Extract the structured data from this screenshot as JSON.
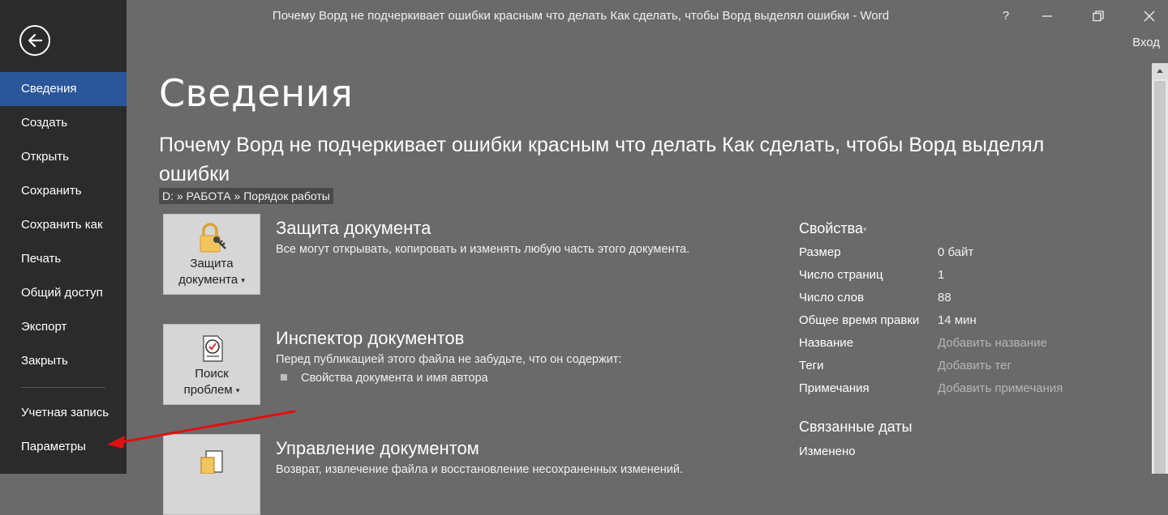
{
  "window": {
    "title": "Почему Ворд не подчеркивает ошибки красным что делать Как сделать, чтобы Ворд выделял ошибки - Word",
    "help": "?",
    "signin": "Вход"
  },
  "sidebar": {
    "items": [
      {
        "label": "Сведения",
        "active": true
      },
      {
        "label": "Создать"
      },
      {
        "label": "Открыть"
      },
      {
        "label": "Сохранить"
      },
      {
        "label": "Сохранить как"
      },
      {
        "label": "Печать"
      },
      {
        "label": "Общий доступ"
      },
      {
        "label": "Экспорт"
      },
      {
        "label": "Закрыть"
      },
      {
        "label": "Учетная запись"
      },
      {
        "label": "Параметры"
      }
    ]
  },
  "main": {
    "title": "Сведения",
    "doc_title": "Почему Ворд не подчеркивает ошибки красным что делать Как сделать, чтобы Ворд выделял ошибки",
    "path": "D: » РАБОТА » Порядок работы",
    "sections": [
      {
        "tile_line1": "Защита",
        "tile_line2": "документа",
        "heading": "Защита документа",
        "desc": "Все могут открывать, копировать и изменять любую часть этого документа."
      },
      {
        "tile_line1": "Поиск",
        "tile_line2": "проблем",
        "heading": "Инспектор документов",
        "desc": "Перед публикацией этого файла не забудьте, что он содержит:",
        "bullet": "Свойства документа и имя автора"
      },
      {
        "heading": "Управление документом",
        "desc": "Возврат, извлечение файла и восстановление несохраненных изменений."
      }
    ]
  },
  "properties": {
    "heading": "Свойства",
    "rows": [
      {
        "name": "Размер",
        "value": "0 байт"
      },
      {
        "name": "Число страниц",
        "value": "1"
      },
      {
        "name": "Число слов",
        "value": "88"
      },
      {
        "name": "Общее время правки",
        "value": "14 мин"
      },
      {
        "name": "Название",
        "value": "Добавить название"
      },
      {
        "name": "Теги",
        "value": "Добавить тег"
      },
      {
        "name": "Примечания",
        "value": "Добавить примечания"
      }
    ],
    "dates_heading": "Связанные даты",
    "dates_rows": [
      {
        "name": "Изменено"
      }
    ]
  },
  "colors": {
    "sidebar_bg": "#2b2b2b",
    "active_item": "#2b579a",
    "main_bg": "#6a6a6a",
    "annotation_arrow": "#e01010"
  },
  "icons": {
    "back": "back-arrow-icon",
    "protect": "lock-key-icon",
    "inspect": "checklist-icon",
    "manage": "document-versions-icon"
  }
}
